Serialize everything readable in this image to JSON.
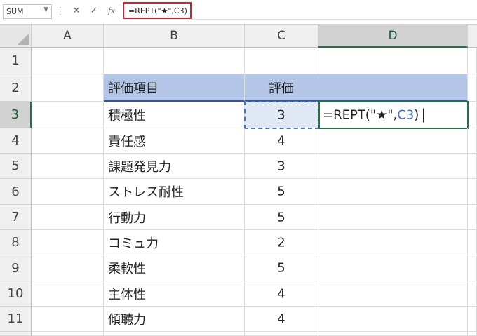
{
  "formula_bar": {
    "name_box": "SUM",
    "cancel_icon": "✕",
    "enter_icon": "✓",
    "function_icon": "fx",
    "formula": "=REPT(\"★\",C3)"
  },
  "columns": [
    "A",
    "B",
    "C",
    "D"
  ],
  "rows": [
    "1",
    "2",
    "3",
    "4",
    "5",
    "6",
    "7",
    "8",
    "9",
    "10",
    "11"
  ],
  "table": {
    "header": [
      "評価項目",
      "評価"
    ],
    "items": [
      {
        "label": "積極性",
        "score": "3"
      },
      {
        "label": "責任感",
        "score": "4"
      },
      {
        "label": "課題発見力",
        "score": "3"
      },
      {
        "label": "ストレス耐性",
        "score": "5"
      },
      {
        "label": "行動力",
        "score": "5"
      },
      {
        "label": "コミュ力",
        "score": "2"
      },
      {
        "label": "柔軟性",
        "score": "5"
      },
      {
        "label": "主体性",
        "score": "4"
      },
      {
        "label": "傾聴力",
        "score": "4"
      }
    ]
  },
  "edit_cell": {
    "prefix": "=REPT(\"★\",",
    "ref": "C3",
    "suffix": ")"
  },
  "colors": {
    "header_fill": "#b4c6e7",
    "header_border": "#2f5597",
    "selection": "#217346",
    "reference": "#4472c4",
    "highlight_box": "#d9202a"
  }
}
